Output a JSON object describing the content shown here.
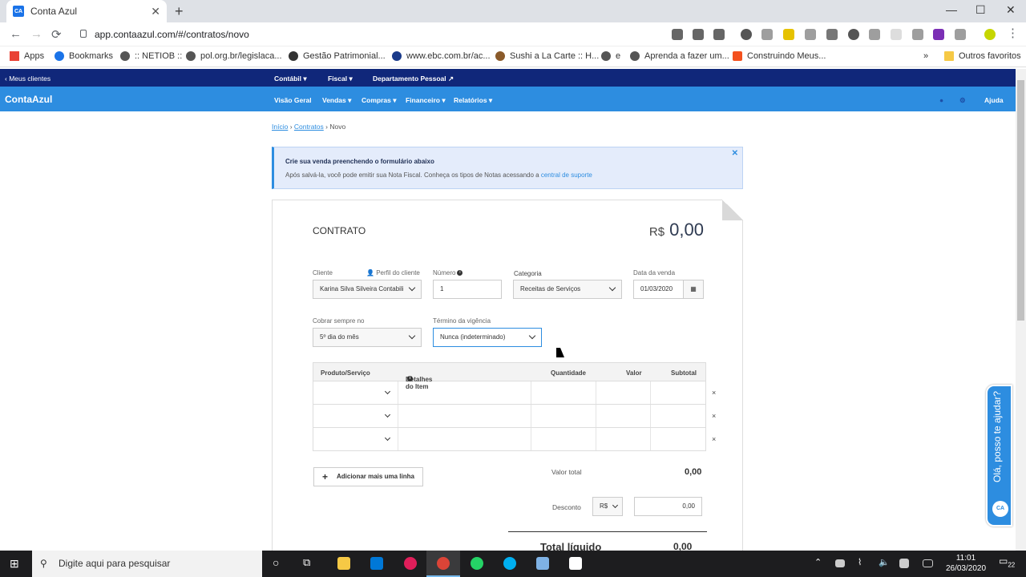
{
  "browser": {
    "tab_title": "Conta Azul",
    "tab_favicon": "CA",
    "new_tab": "+",
    "tab_close": "✕",
    "minimize": "—",
    "maximize": "☐",
    "close": "✕",
    "back": "←",
    "forward": "→",
    "reload": "⟳",
    "url": "app.contaazul.com/#/contratos/novo",
    "bookmarks": [
      {
        "label": "Apps"
      },
      {
        "label": "Bookmarks"
      },
      {
        "label": ":: NETIOB ::"
      },
      {
        "label": "pol.org.br/legislaca..."
      },
      {
        "label": "Gestão Patrimonial..."
      },
      {
        "label": "www.ebc.com.br/ac..."
      },
      {
        "label": "Sushi a La Carte :: H..."
      },
      {
        "label": "e"
      },
      {
        "label": "Aprenda a fazer um..."
      },
      {
        "label": "Construindo Meus..."
      }
    ],
    "bookmarks_more": "»",
    "other_bookmarks": "Outros favoritos"
  },
  "topnav": {
    "back_link": "‹ Meus clientes",
    "items": [
      "Contábil ▾",
      "Fiscal ▾",
      "Departamento Pessoal ↗"
    ]
  },
  "mainnav": {
    "logo": "ContaAzul",
    "items": [
      "Visão Geral",
      "Vendas ▾",
      "Compras ▾",
      "Financeiro ▾",
      "Relatórios ▾"
    ],
    "user_icon": "●",
    "settings_icon": "⚙",
    "help": "Ajuda"
  },
  "breadcrumb": {
    "home": "Início",
    "section": "Contratos",
    "current": "Novo",
    "sep": "›"
  },
  "alert": {
    "title": "Crie sua venda preenchendo o formulário abaixo",
    "text": "Após salvá-la, você pode emitir sua Nota Fiscal. Conheça os tipos de Notas acessando a ",
    "link": "central de suporte",
    "close": "✕"
  },
  "form": {
    "title": "CONTRATO",
    "currency": "R$",
    "total": "0,00",
    "cliente_label": "Cliente",
    "perfil_link": "Perfil do cliente",
    "cliente_value": "Karina Silva Silveira Contabili",
    "numero_label": "Número",
    "numero_value": "1",
    "categoria_label": "Categoria",
    "categoria_value": "Receitas de Serviços",
    "data_label": "Data da venda",
    "data_value": "01/03/2020",
    "cobrar_label": "Cobrar sempre no",
    "cobrar_value": "5º dia do mês",
    "termino_label": "Término da vigência",
    "termino_value": "Nunca (indeterminado)"
  },
  "table": {
    "headers": [
      "Produto/Serviço",
      "Detalhes do Item",
      "Quantidade",
      "Valor",
      "Subtotal"
    ],
    "remove": "×",
    "add_line": "Adicionar mais uma linha"
  },
  "totals": {
    "valor_total_label": "Valor total",
    "valor_total": "0,00",
    "desconto_label": "Desconto",
    "desconto_currency": "R$",
    "desconto_value": "0,00",
    "liquido_label": "Total líquido",
    "liquido_value": "0,00"
  },
  "chat": {
    "text": "Olá, posso te ajudar?",
    "badge": "CA"
  },
  "taskbar": {
    "search_placeholder": "Digite aqui para pesquisar",
    "time": "11:01",
    "date": "26/03/2020",
    "notifications": "22"
  }
}
